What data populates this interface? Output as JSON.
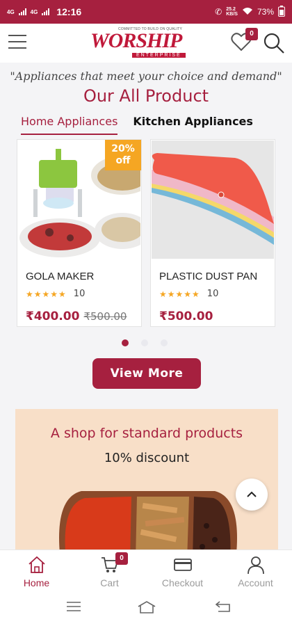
{
  "status_bar": {
    "signal1": "4G",
    "signal2": "4G",
    "time": "12:16",
    "net_speed_value": "25.2",
    "net_speed_unit": "KB/S",
    "battery": "73%"
  },
  "header": {
    "logo_main": "WORSHIP",
    "logo_tagline": "COMMITTED TO BUILD ON QUALITY",
    "logo_sub": "ENTERPRISE",
    "wishlist_count": "0"
  },
  "tagline": "\"Appliances that meet your choice and demand\"",
  "section_title": "Our All Product",
  "tabs": [
    {
      "label": "Home Appliances",
      "active": true
    },
    {
      "label": "Kitchen Appliances",
      "active": false
    }
  ],
  "products": [
    {
      "name": "GOLA MAKER",
      "stars": "★★★★★",
      "rating_count": "10",
      "price": "₹400.00",
      "old_price": "₹500.00",
      "discount": "20%\noff"
    },
    {
      "name": "PLASTIC DUST PAN",
      "stars": "★★★★★",
      "rating_count": "10",
      "price": "₹500.00"
    }
  ],
  "carousel": {
    "pages": 3,
    "active": 0
  },
  "view_more_label": "View More",
  "promo": {
    "title": "A shop for standard products",
    "subtitle": "10% discount"
  },
  "bottom_nav": [
    {
      "label": "Home",
      "icon": "home-icon",
      "active": true
    },
    {
      "label": "Cart",
      "icon": "cart-icon",
      "active": false
    },
    {
      "label": "Checkout",
      "icon": "card-icon",
      "active": false
    },
    {
      "label": "Account",
      "icon": "user-icon",
      "active": false
    }
  ],
  "cart_count": "0",
  "colors": {
    "brand": "#a6203f",
    "star": "#f5a623",
    "promo_bg": "#f8dfc8"
  }
}
